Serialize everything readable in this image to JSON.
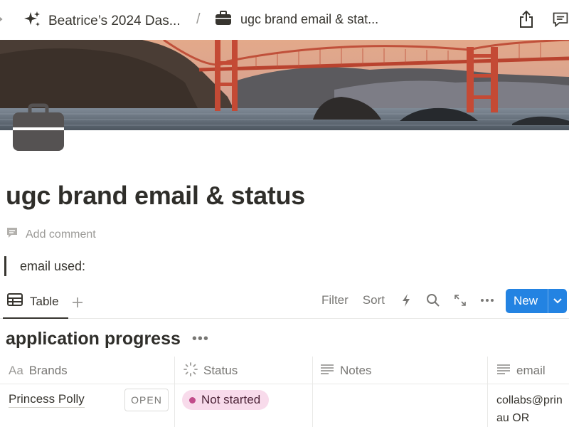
{
  "breadcrumb": {
    "workspace": "Beatrice’s 2024 Das...",
    "separator": "/",
    "page": "ugc brand email & stat..."
  },
  "page": {
    "title": "ugc brand email & status",
    "add_comment": "Add comment",
    "quote_text": "email used:"
  },
  "database": {
    "view_tab": "Table",
    "actions": {
      "filter": "Filter",
      "sort": "Sort"
    },
    "new_button": "New",
    "title": "application progress",
    "title_menu": "•••",
    "columns": [
      {
        "label": "Brands",
        "prefix": "Aa",
        "icon": "title-property-icon"
      },
      {
        "label": "Status",
        "icon": "status-property-icon"
      },
      {
        "label": "Notes",
        "icon": "text-property-icon"
      },
      {
        "label": "email",
        "icon": "text-property-icon"
      }
    ],
    "rows": [
      {
        "brand": "Princess Polly",
        "open_label": "OPEN",
        "status": "Not started",
        "notes": "",
        "email_line1": "collabs@prin",
        "email_line2": "au OR"
      }
    ]
  },
  "colors": {
    "accent": "#2383e2",
    "status_bg": "#f8dbeb",
    "status_dot": "#c14c8a",
    "text": "#37352f",
    "muted": "#787774"
  }
}
